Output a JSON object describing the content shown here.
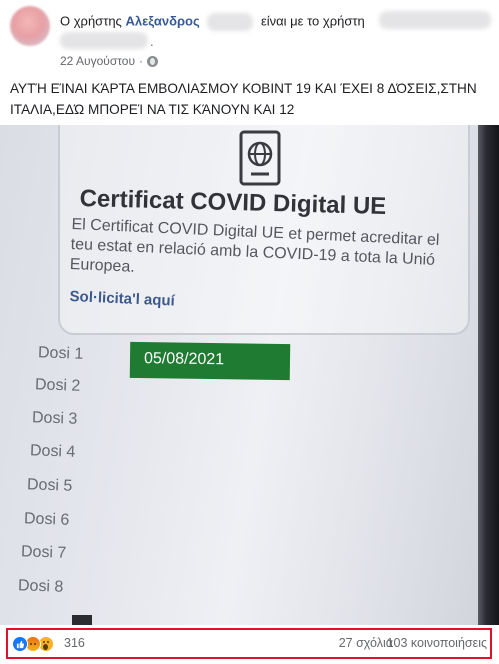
{
  "header": {
    "prefix": "Ο χρήστης",
    "author": "Αλεξανδρος",
    "with_text": "είναι με το χρήστη",
    "trailing_dot": ".",
    "date": "22 Αυγούστου",
    "privacy_icon": "globe-icon"
  },
  "post": {
    "text": "ΑΥΤΉ ΕΊΝΑΙ ΚΆΡΤΑ ΕΜΒΟΛΙΑΣΜΟΥ ΚΟΒΙΝΤ 19 ΚΑΙ ΈΧΕΙ 8 ΔΌΣΕΙΣ,ΣΤΗΝ ΙΤΑΛΙΑ,ΕΔΏ ΜΠΟΡΕΊ ΝΑ ΤΙΣ ΚΆΝΟΥΝ ΚΑΙ 12"
  },
  "photo": {
    "card_icon": "passport-globe-icon",
    "title": "Certificat COVID Digital UE",
    "description": "El Certificat COVID Digital UE et permet acreditar el teu estat en relació amb la COVID-19 a tota la Unió Europea.",
    "link": "Sol·licita'l aquí",
    "doses": [
      "Dosi 1",
      "Dosi 2",
      "Dosi 3",
      "Dosi 4",
      "Dosi 5",
      "Dosi 6",
      "Dosi 7",
      "Dosi 8"
    ],
    "dose1_date": "05/08/2021",
    "date_box_color": "#1f7a32"
  },
  "footer": {
    "reaction_icons": [
      "like-icon",
      "angry-icon",
      "wow-icon"
    ],
    "reaction_count": "316",
    "comments": "27 σχόλια",
    "shares": "103 κοινοποιήσεις",
    "highlight_color": "#e0122b"
  }
}
